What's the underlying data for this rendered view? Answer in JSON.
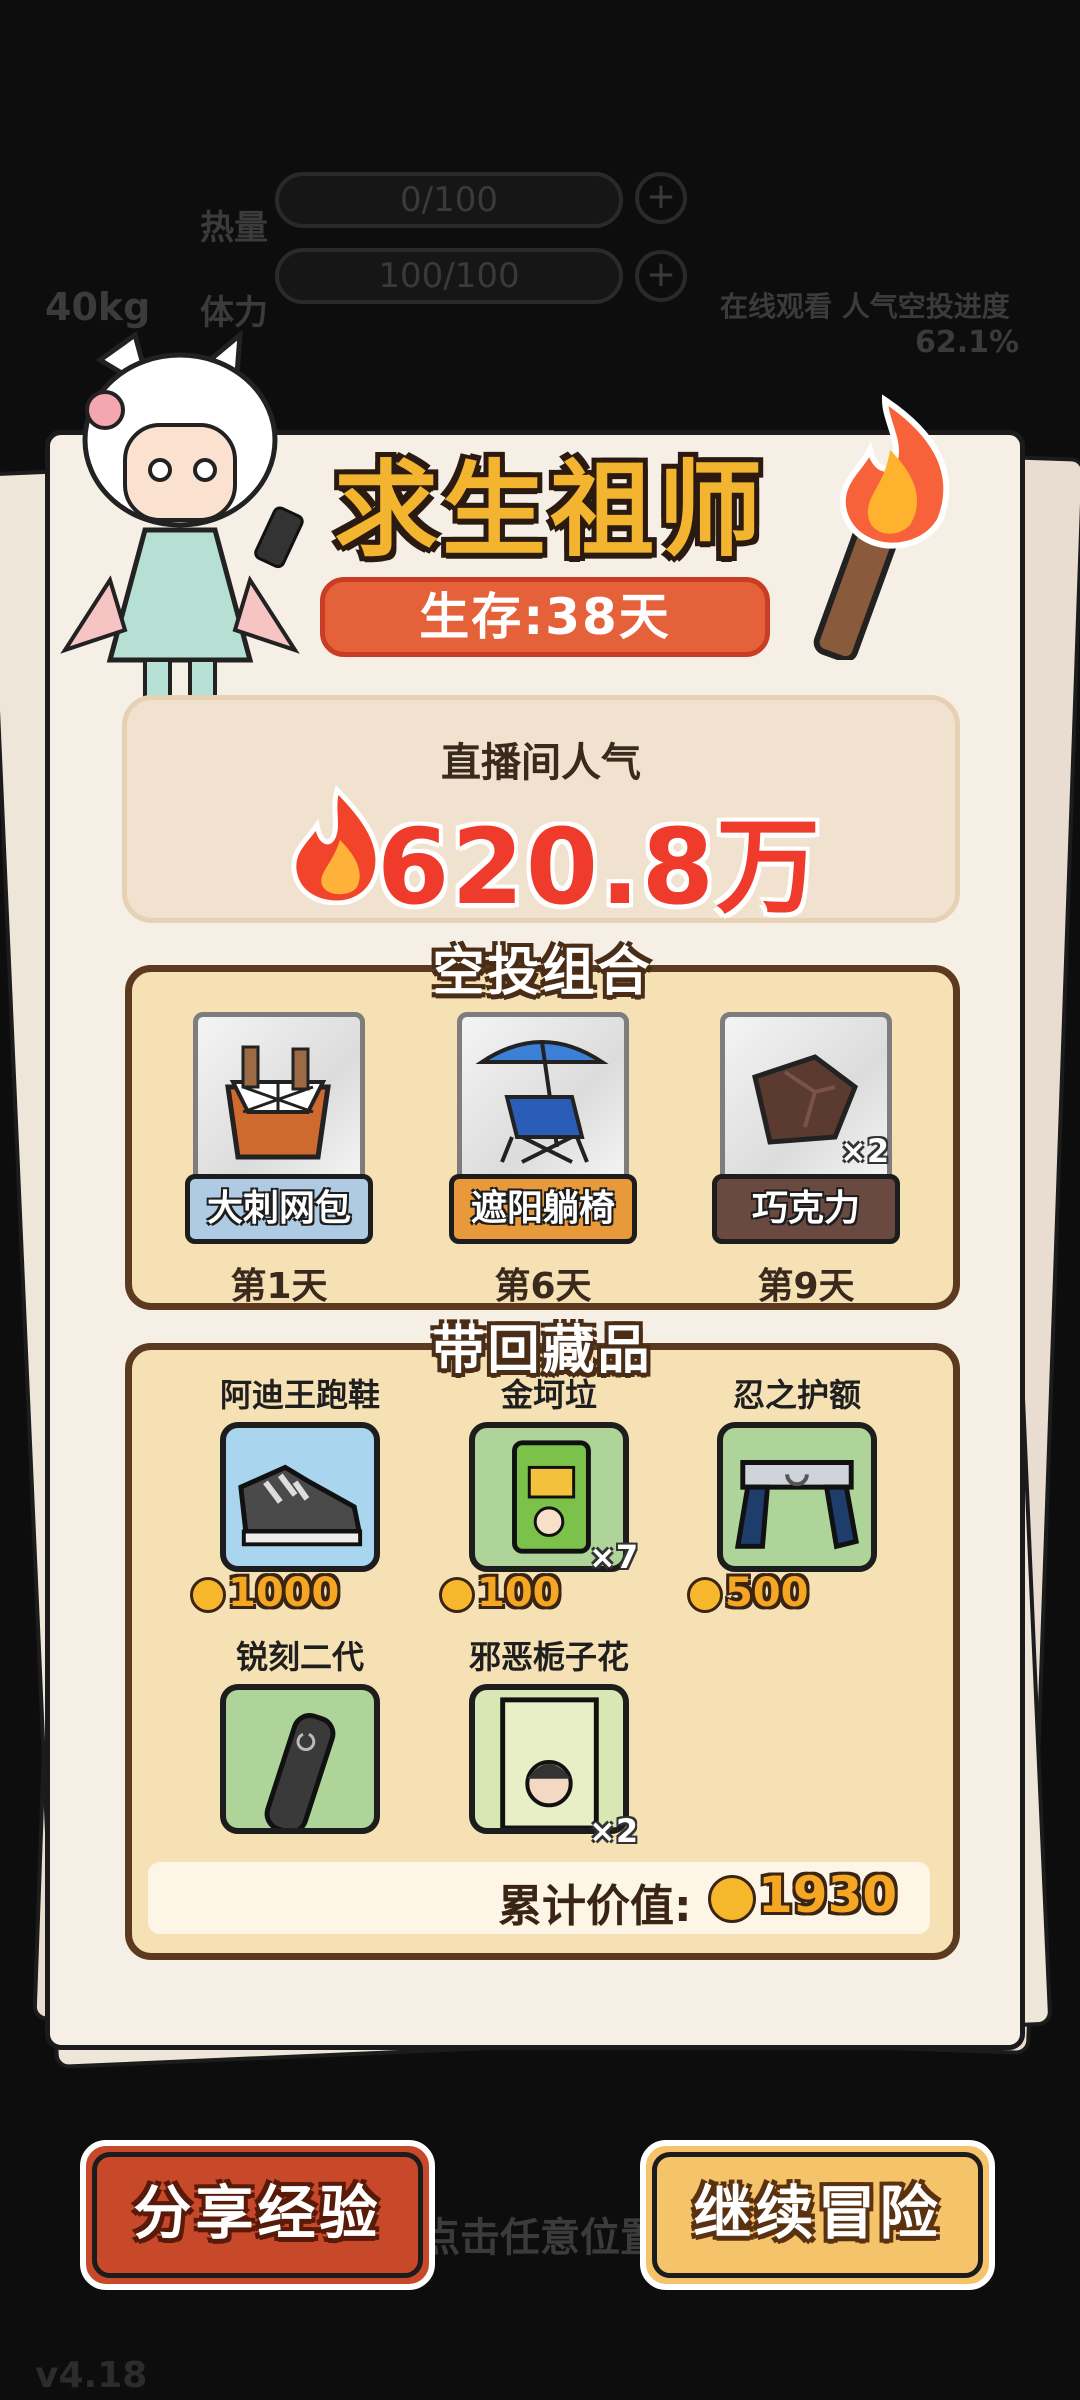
{
  "background_hud": {
    "heat_label": "热量",
    "heat_value": "0/100",
    "stamina_label": "体力",
    "stamina_value": "100/100",
    "weight": "40kg",
    "watch_text": "在线观看 人气空投进度",
    "airdrop_progress": "62.1%",
    "hint_text": "点击任意位置关闭",
    "version": "v4.18"
  },
  "title": "求生祖师",
  "survival": "生存:38天",
  "popularity": {
    "label": "直播间人气",
    "value": "620.8万"
  },
  "airdrop": {
    "title": "空投组合",
    "items": [
      {
        "name": "大刺网包",
        "day": "第1天",
        "color": "#aecbe3",
        "icon": "net-bag-icon"
      },
      {
        "name": "遮阳躺椅",
        "day": "第6天",
        "color": "#e89a3a",
        "icon": "beach-chair-icon"
      },
      {
        "name": "巧克力",
        "day": "第9天",
        "color": "#6a4a40",
        "icon": "chocolate-icon",
        "qty": "×2"
      }
    ]
  },
  "collection": {
    "title": "带回藏品",
    "items": [
      {
        "name": "阿迪王跑鞋",
        "price": "1000",
        "icon": "sneaker-icon",
        "bg": "#a9d6ee"
      },
      {
        "name": "金坷垃",
        "price": "100",
        "icon": "fertilizer-bag-icon",
        "bg": "#aed49a",
        "qty": "×7"
      },
      {
        "name": "忍之护额",
        "price": "500",
        "icon": "ninja-headband-icon",
        "bg": "#aed49a"
      },
      {
        "name": "锐刻二代",
        "icon": "vape-icon",
        "bg": "#aed49a"
      },
      {
        "name": "邪恶栀子花",
        "icon": "poster-icon",
        "bg": "#d8e7b3",
        "qty": "×2"
      }
    ],
    "total_label": "累计价值:",
    "total_value": "1930"
  },
  "buttons": {
    "share": "分享经验",
    "continue": "继续冒险"
  }
}
